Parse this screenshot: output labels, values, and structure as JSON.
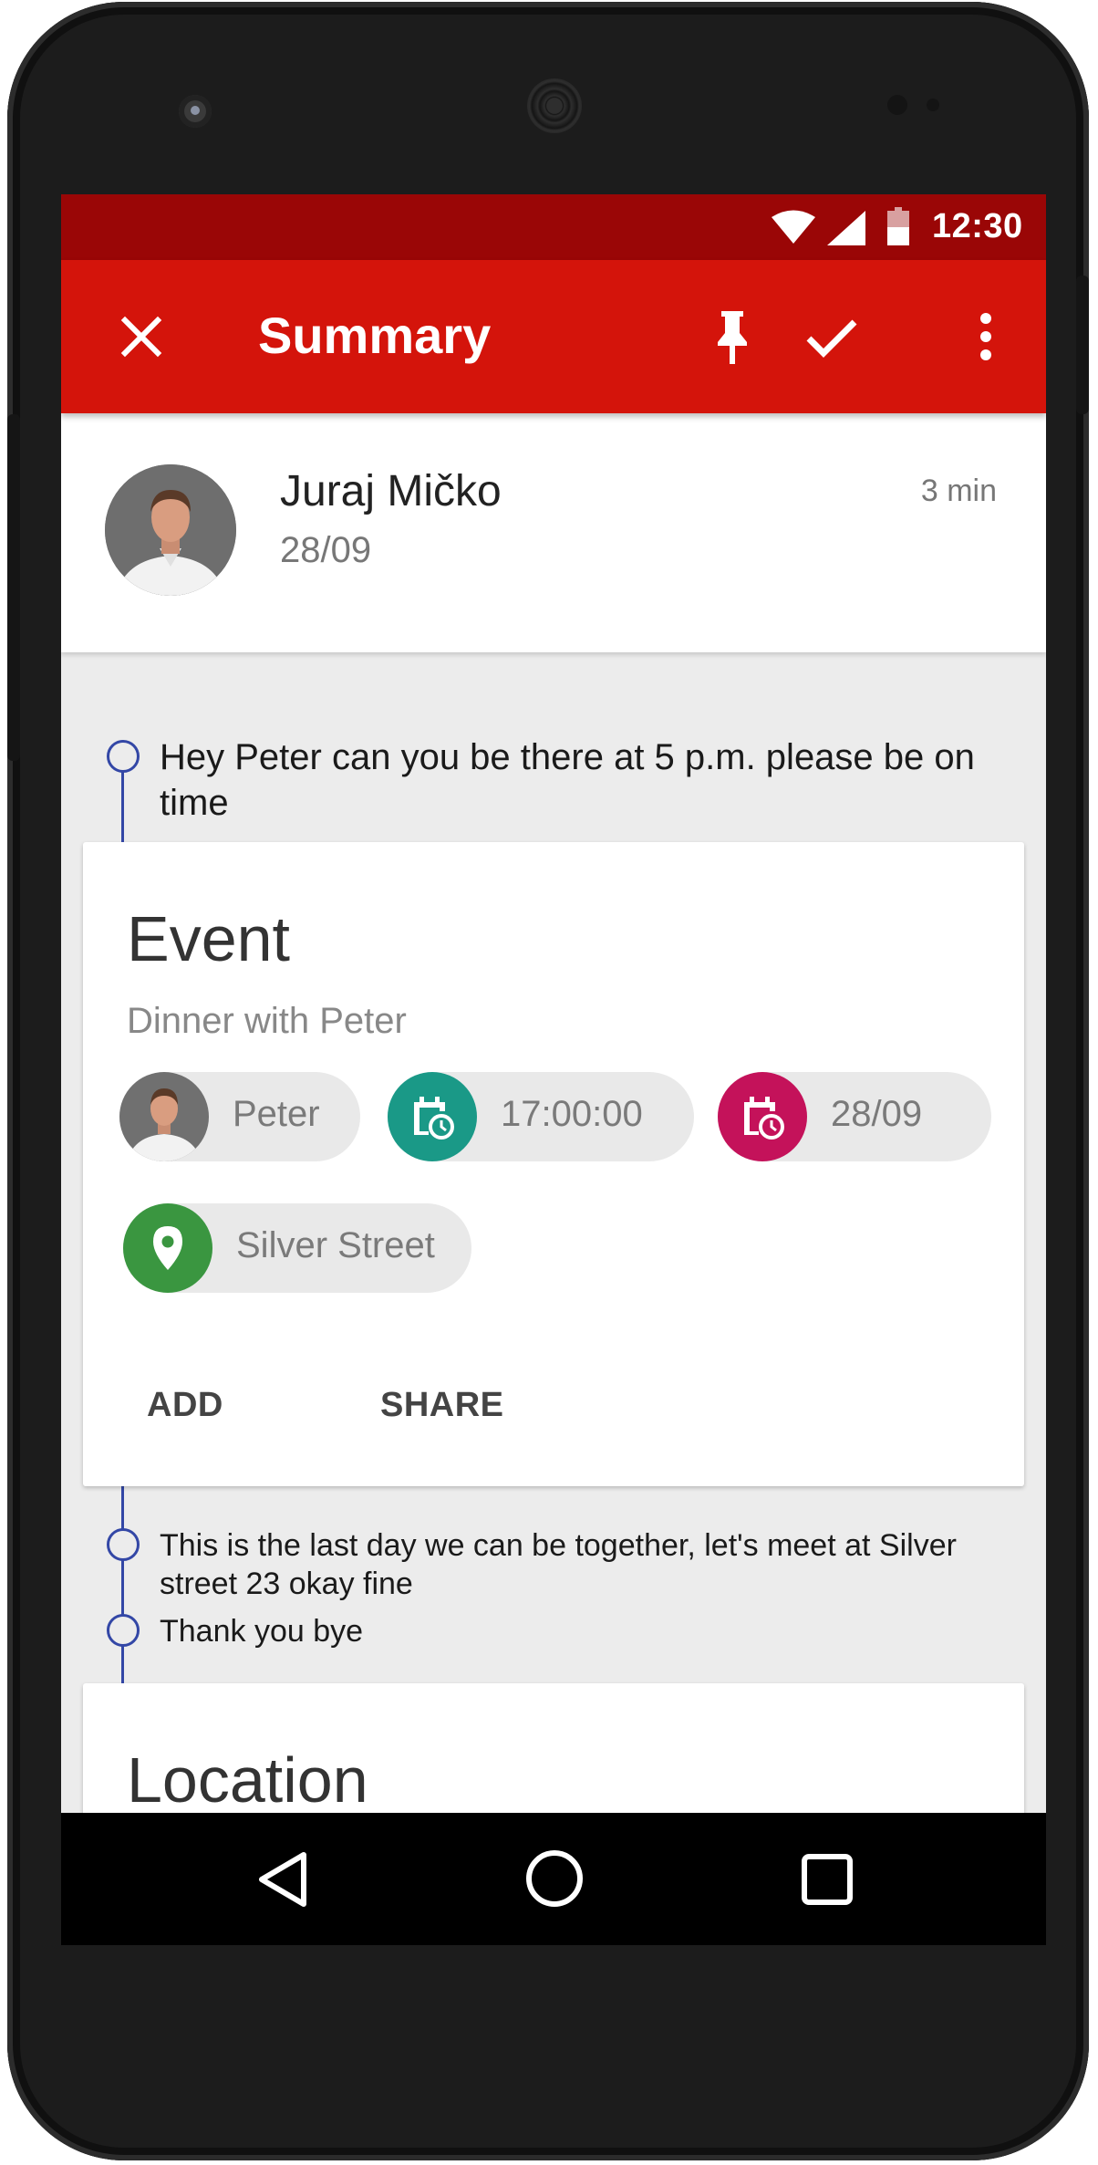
{
  "status_bar": {
    "time": "12:30"
  },
  "app_bar": {
    "title": "Summary",
    "icons": [
      "close-icon",
      "pin-icon",
      "check-icon",
      "more-vert-icon"
    ],
    "color": "#d4140b",
    "status_color": "#9a0606"
  },
  "conversation": {
    "sender_name": "Juraj Mičko",
    "date": "28/09",
    "time_ago": "3 min"
  },
  "messages": [
    "Hey Peter can you be there at 5 p.m. please be on time",
    "This is the last day we can be together, let's meet at Silver street 23 okay fine",
    "Thank you bye"
  ],
  "event_card": {
    "title": "Event",
    "subtitle": "Dinner with Peter",
    "chips": {
      "person": "Peter",
      "time": "17:00:00",
      "date": "28/09",
      "place": "Silver Street"
    },
    "chip_colors": {
      "time": "#1a9987",
      "date": "#c4125a",
      "place": "#3a9640"
    },
    "actions": {
      "add": "ADD",
      "share": "SHARE"
    }
  },
  "location_card": {
    "title": "Location"
  },
  "timeline_color": "#3347a6",
  "nav_bar": {
    "icons": [
      "back-icon",
      "home-icon",
      "recents-icon"
    ]
  }
}
